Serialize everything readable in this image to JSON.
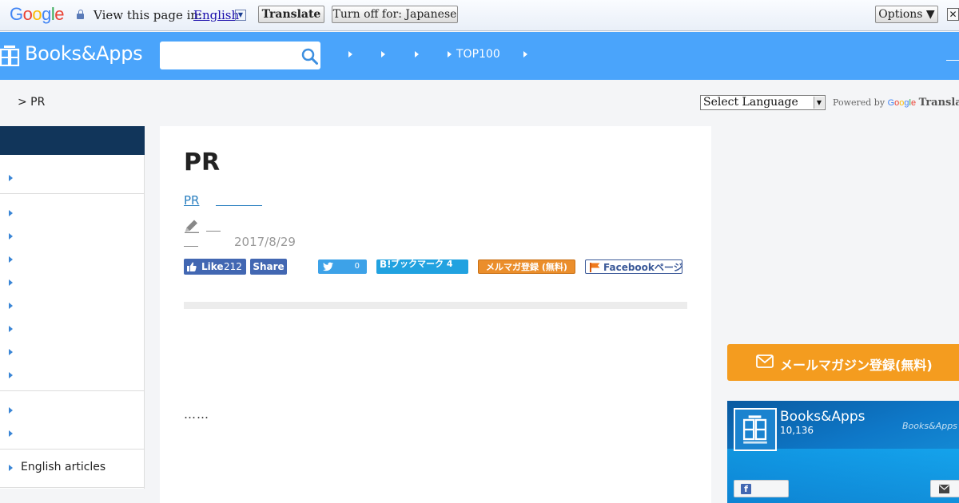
{
  "translate_bar": {
    "google_logo": "Google",
    "view_label": "View this page in:",
    "language": "English",
    "translate_button": "Translate",
    "turn_off_button": "Turn off for: Japanese",
    "options_button": "Options ▼",
    "close_label": "✕"
  },
  "header": {
    "logo_text": "Books&Apps",
    "search_placeholder": "",
    "nav": [
      "",
      "",
      "",
      "TOP100",
      ""
    ]
  },
  "breadcrumb": "> PR",
  "language_select": {
    "label": "Select Language",
    "powered_by": "Powered by",
    "google": "Google",
    "translate": "Translate"
  },
  "sidebar": {
    "items": [
      "",
      "",
      "",
      "",
      "",
      "",
      "",
      "",
      "",
      "",
      "",
      "English articles"
    ]
  },
  "article": {
    "title": "PR",
    "category": "PR",
    "date": "2017/8/29",
    "ellipsis": "……"
  },
  "share": {
    "fb_like_label": "Like",
    "fb_like_count": "212",
    "fb_share_label": "Share",
    "tweet_count": "0",
    "hatena_b": "B!",
    "hatena_label": "ブックマーク 4",
    "mail_label": "メルマガ登録 (無料)",
    "fb_page_label": "Facebookページ"
  },
  "right": {
    "mail_button": "メールマガジン登録(無料)",
    "fb_name": "Books&Apps",
    "fb_likes": "10,136",
    "fb_watermark": "Books&Apps"
  },
  "colors": {
    "header_blue": "#4aa4fb",
    "sidebar_head": "#11355a",
    "link": "#2a7fc0",
    "mail_orange": "#f49c1f"
  }
}
